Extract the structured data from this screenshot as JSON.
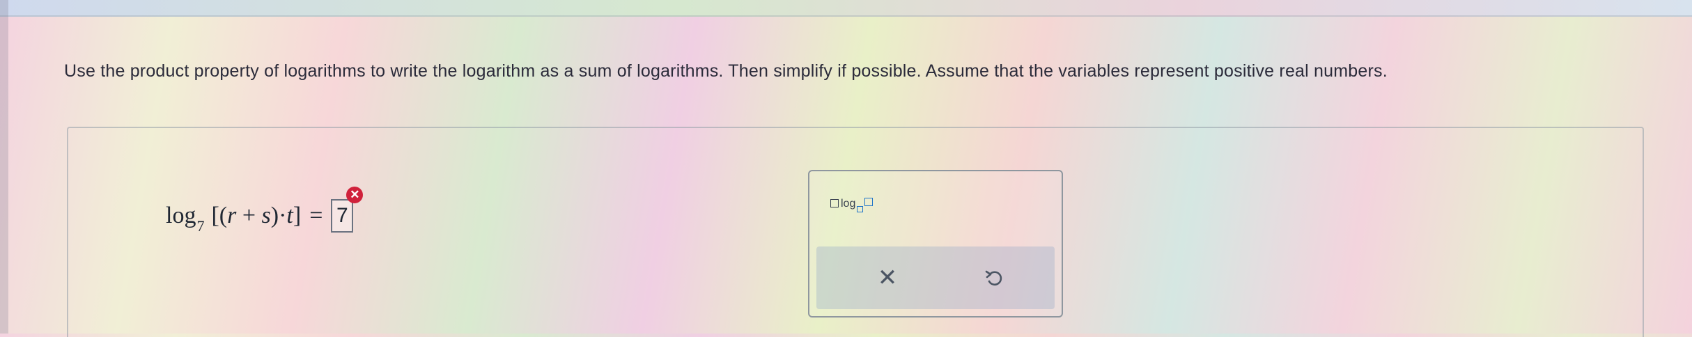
{
  "question": {
    "text": "Use the product property of logarithms to write the logarithm as a sum of logarithms. Then simplify if possible. Assume that the variables represent positive real numbers."
  },
  "equation": {
    "log": "log",
    "base": "7",
    "open_bracket": "[(",
    "var_r": "r",
    "plus": " + ",
    "var_s": "s",
    "close_paren_dot": ")·",
    "var_t": "t",
    "close_bracket": "]",
    "equals": "=",
    "answer_value": "7",
    "error_mark": "✕"
  },
  "toolbox": {
    "log_template_label": "log",
    "clear_symbol": "✕",
    "undo_icon": "undo-icon"
  },
  "colors": {
    "error": "#d0213b",
    "template_blue": "#1d73c9"
  }
}
